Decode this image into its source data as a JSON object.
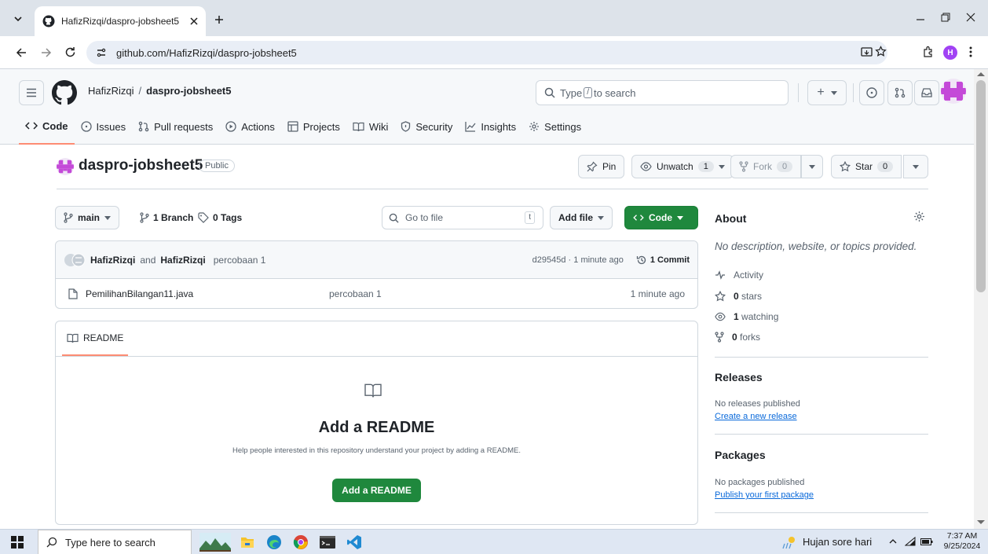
{
  "browser": {
    "tab_title": "HafizRizqi/daspro-jobsheet5",
    "url": "github.com/HafizRizqi/daspro-jobsheet5",
    "profile_initial": "H"
  },
  "header": {
    "owner": "HafizRizqi",
    "slash": "/",
    "repo": "daspro-jobsheet5",
    "search_prefix": "Type",
    "search_key": "/",
    "search_suffix": "to search",
    "plus": "+"
  },
  "nav": {
    "code": "Code",
    "issues": "Issues",
    "pulls": "Pull requests",
    "actions": "Actions",
    "projects": "Projects",
    "wiki": "Wiki",
    "security": "Security",
    "insights": "Insights",
    "settings": "Settings"
  },
  "repo": {
    "name": "daspro-jobsheet5",
    "visibility": "Public",
    "pin": "Pin",
    "unwatch": "Unwatch",
    "watch_count": "1",
    "fork": "Fork",
    "fork_count": "0",
    "star": "Star",
    "star_count": "0"
  },
  "toolbar": {
    "branch": "main",
    "branches": "1 Branch",
    "tags": "0 Tags",
    "goto_placeholder": "Go to file",
    "goto_key": "t",
    "add_file": "Add file",
    "code_btn": "Code"
  },
  "commit": {
    "author1": "HafizRizqi",
    "and": "and",
    "author2": "HafizRizqi",
    "message": "percobaan 1",
    "sha_time": "d29545d · 1 minute ago",
    "count": "1 Commit"
  },
  "files": [
    {
      "name": "PemilihanBilangan11.java",
      "message": "percobaan 1",
      "time": "1 minute ago"
    }
  ],
  "readme": {
    "tab": "README",
    "title": "Add a README",
    "desc": "Help people interested in this repository understand your project by adding a README.",
    "button": "Add a README"
  },
  "about": {
    "title": "About",
    "desc": "No description, website, or topics provided.",
    "activity": "Activity",
    "stars": "0 stars",
    "stars_num": "0",
    "stars_word": "stars",
    "watching_num": "1",
    "watching_word": "watching",
    "forks_num": "0",
    "forks_word": "forks"
  },
  "releases": {
    "title": "Releases",
    "none": "No releases published",
    "link": "Create a new release"
  },
  "packages": {
    "title": "Packages",
    "none": "No packages published",
    "link": "Publish your first package"
  },
  "taskbar": {
    "search_placeholder": "Type here to search",
    "weather": "Hujan sore hari",
    "time": "7:37 AM",
    "date": "9/25/2024"
  }
}
